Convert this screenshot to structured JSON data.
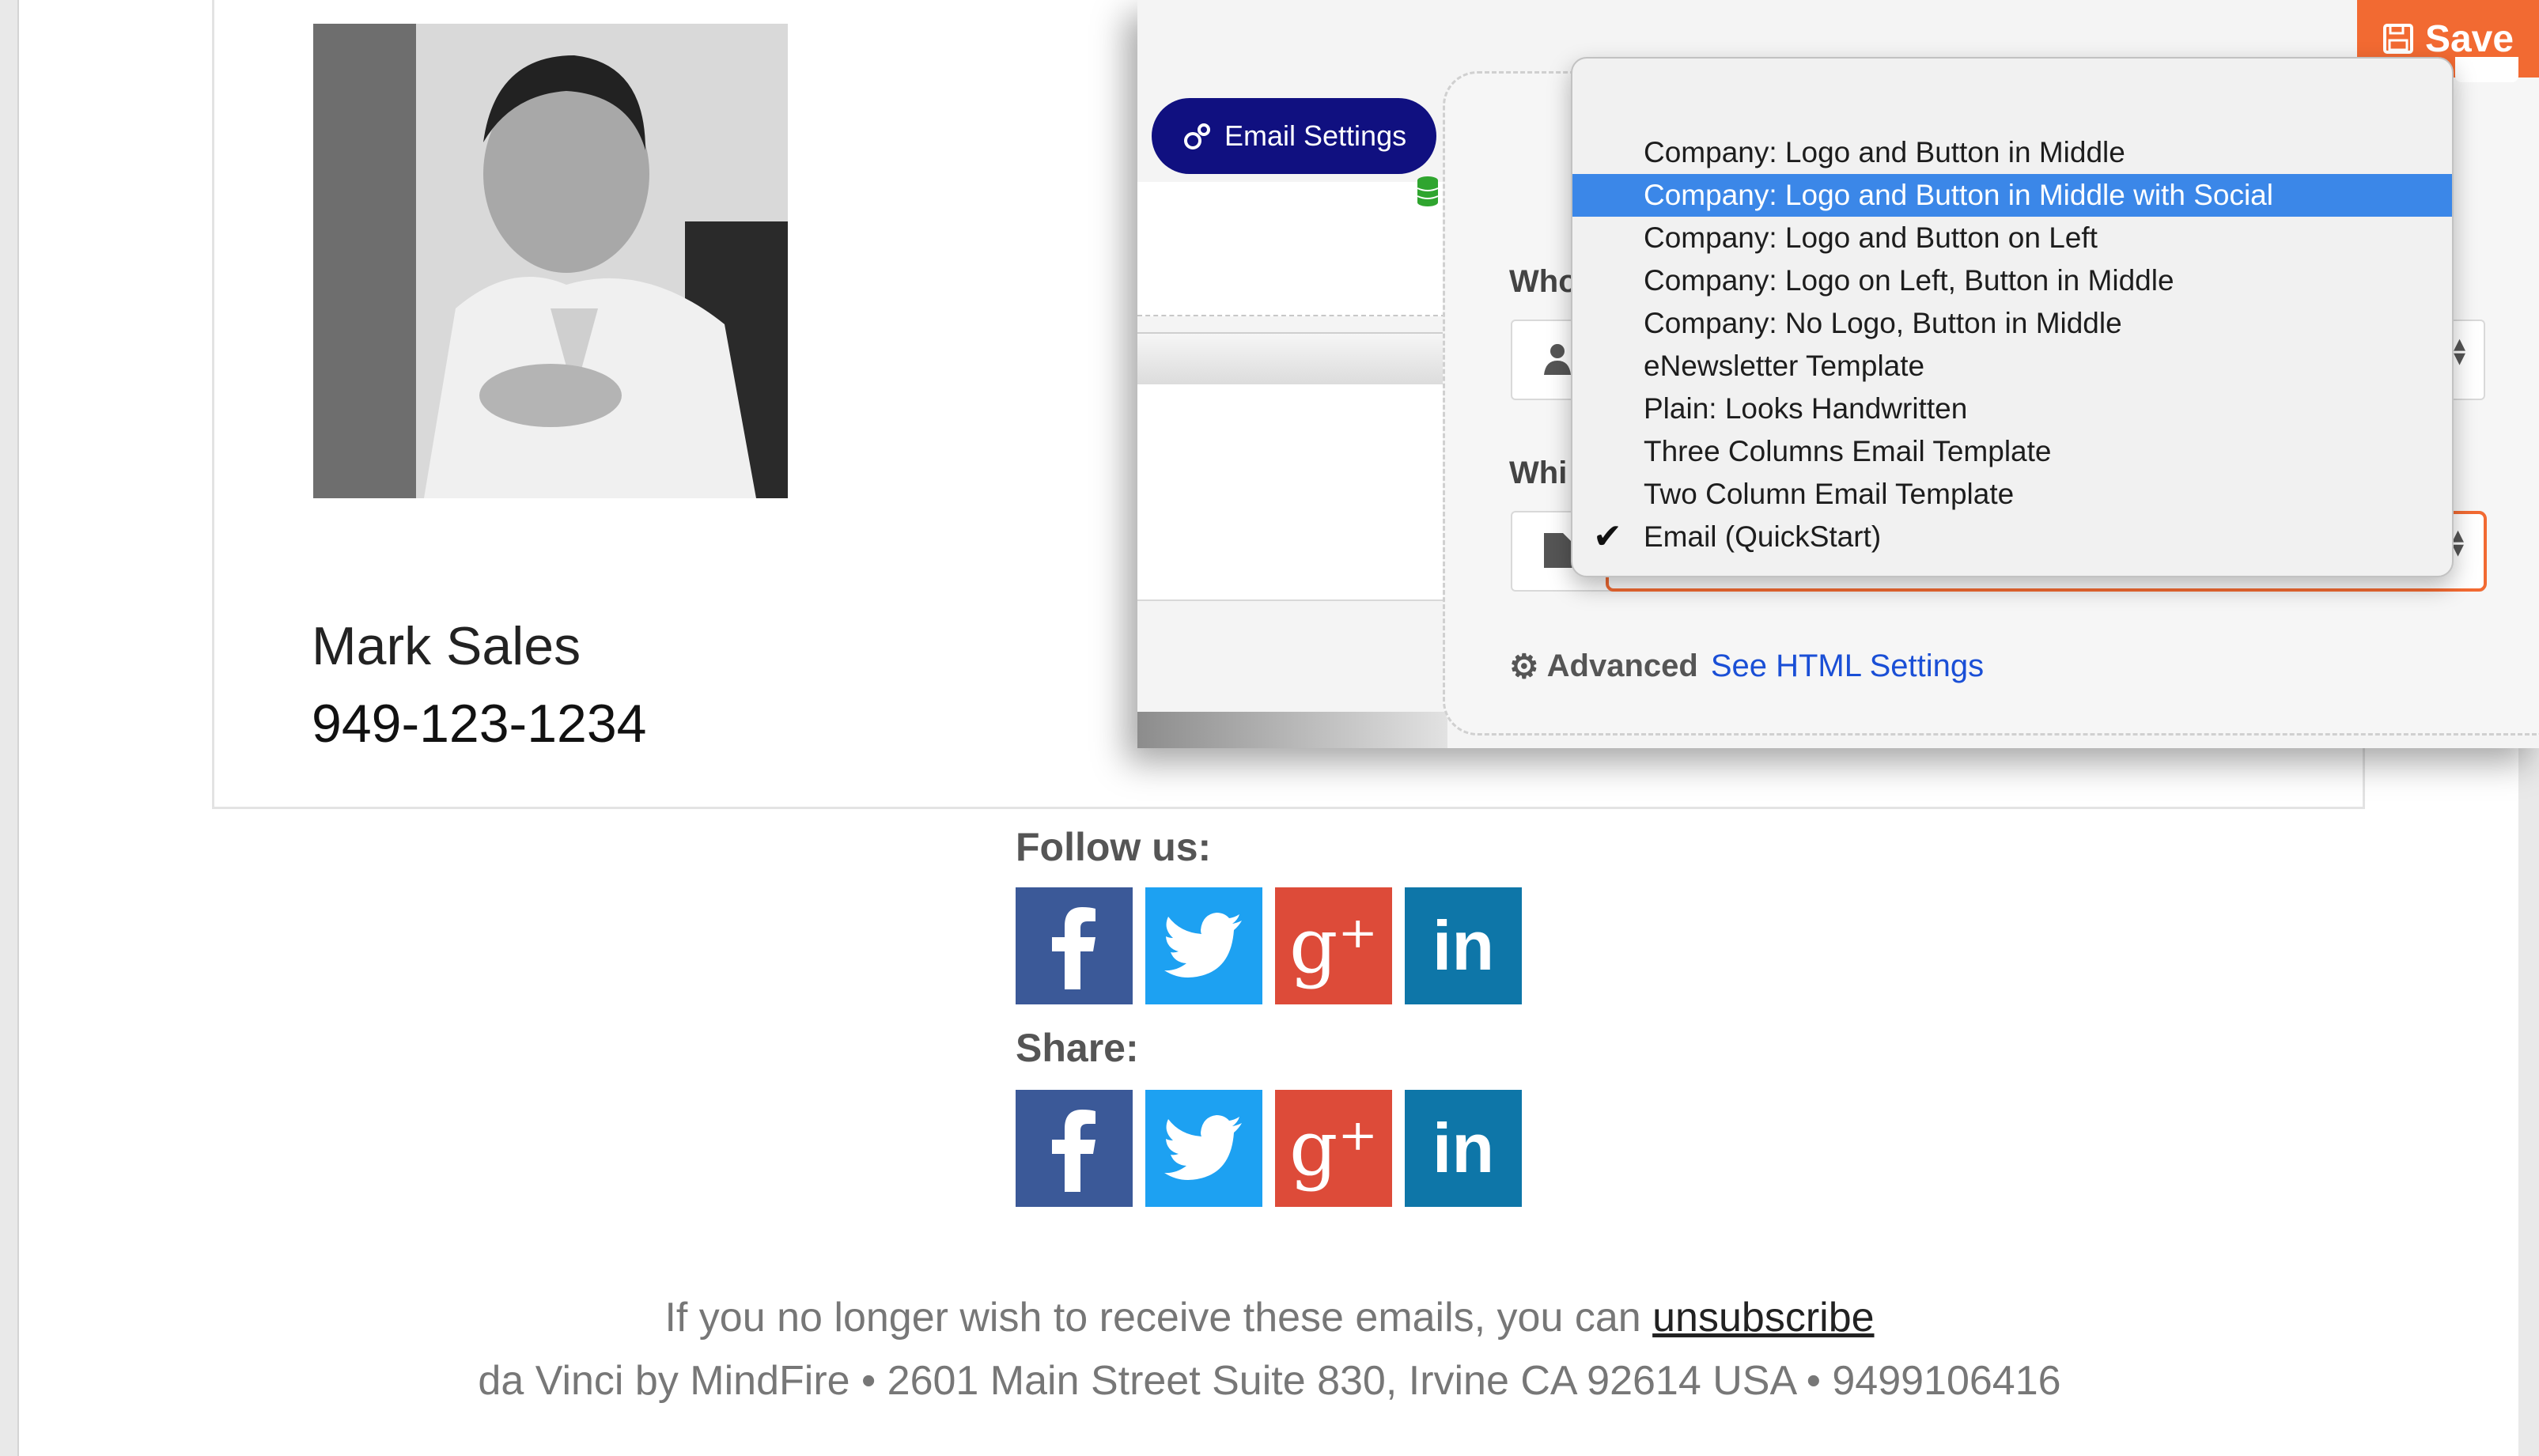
{
  "contact": {
    "name": "Mark Sales",
    "phone": "949-123-1234"
  },
  "follow": {
    "title": "Follow us:",
    "icons": [
      "facebook-icon",
      "twitter-icon",
      "google-plus-icon",
      "linkedin-icon"
    ]
  },
  "share": {
    "title": "Share:",
    "icons": [
      "facebook-icon",
      "twitter-icon",
      "google-plus-icon",
      "linkedin-icon"
    ]
  },
  "footer": {
    "unsubscribe_text": "If you no longer wish to receive these emails, you can",
    "unsubscribe_link": "unsubscribe",
    "address": "da Vinci by MindFire • 2601 Main Street Suite 830, Irvine CA 92614 USA • 9499106416"
  },
  "editor": {
    "email_settings_label": "Email Settings",
    "save_label": "Save",
    "who_label": "Who",
    "which_label": "Whi",
    "advanced_label": "Advanced",
    "html_settings_link": "See HTML Settings",
    "accent_color": "#f26a32",
    "button_color": "#101080",
    "highlight_color": "#3b87e8"
  },
  "template_dropdown": {
    "options": [
      "Company: Logo and Button in Middle",
      "Company: Logo and Button in Middle with Social",
      "Company: Logo and Button on Left",
      "Company: Logo on Left, Button in Middle",
      "Company: No Logo, Button in Middle",
      "eNewsletter Template",
      "Plain: Looks Handwritten",
      "Three Columns Email Template",
      "Two Column Email Template",
      "Email (QuickStart)"
    ],
    "highlighted": "Company: Logo and Button in Middle with Social",
    "checked": "Email (QuickStart)"
  }
}
